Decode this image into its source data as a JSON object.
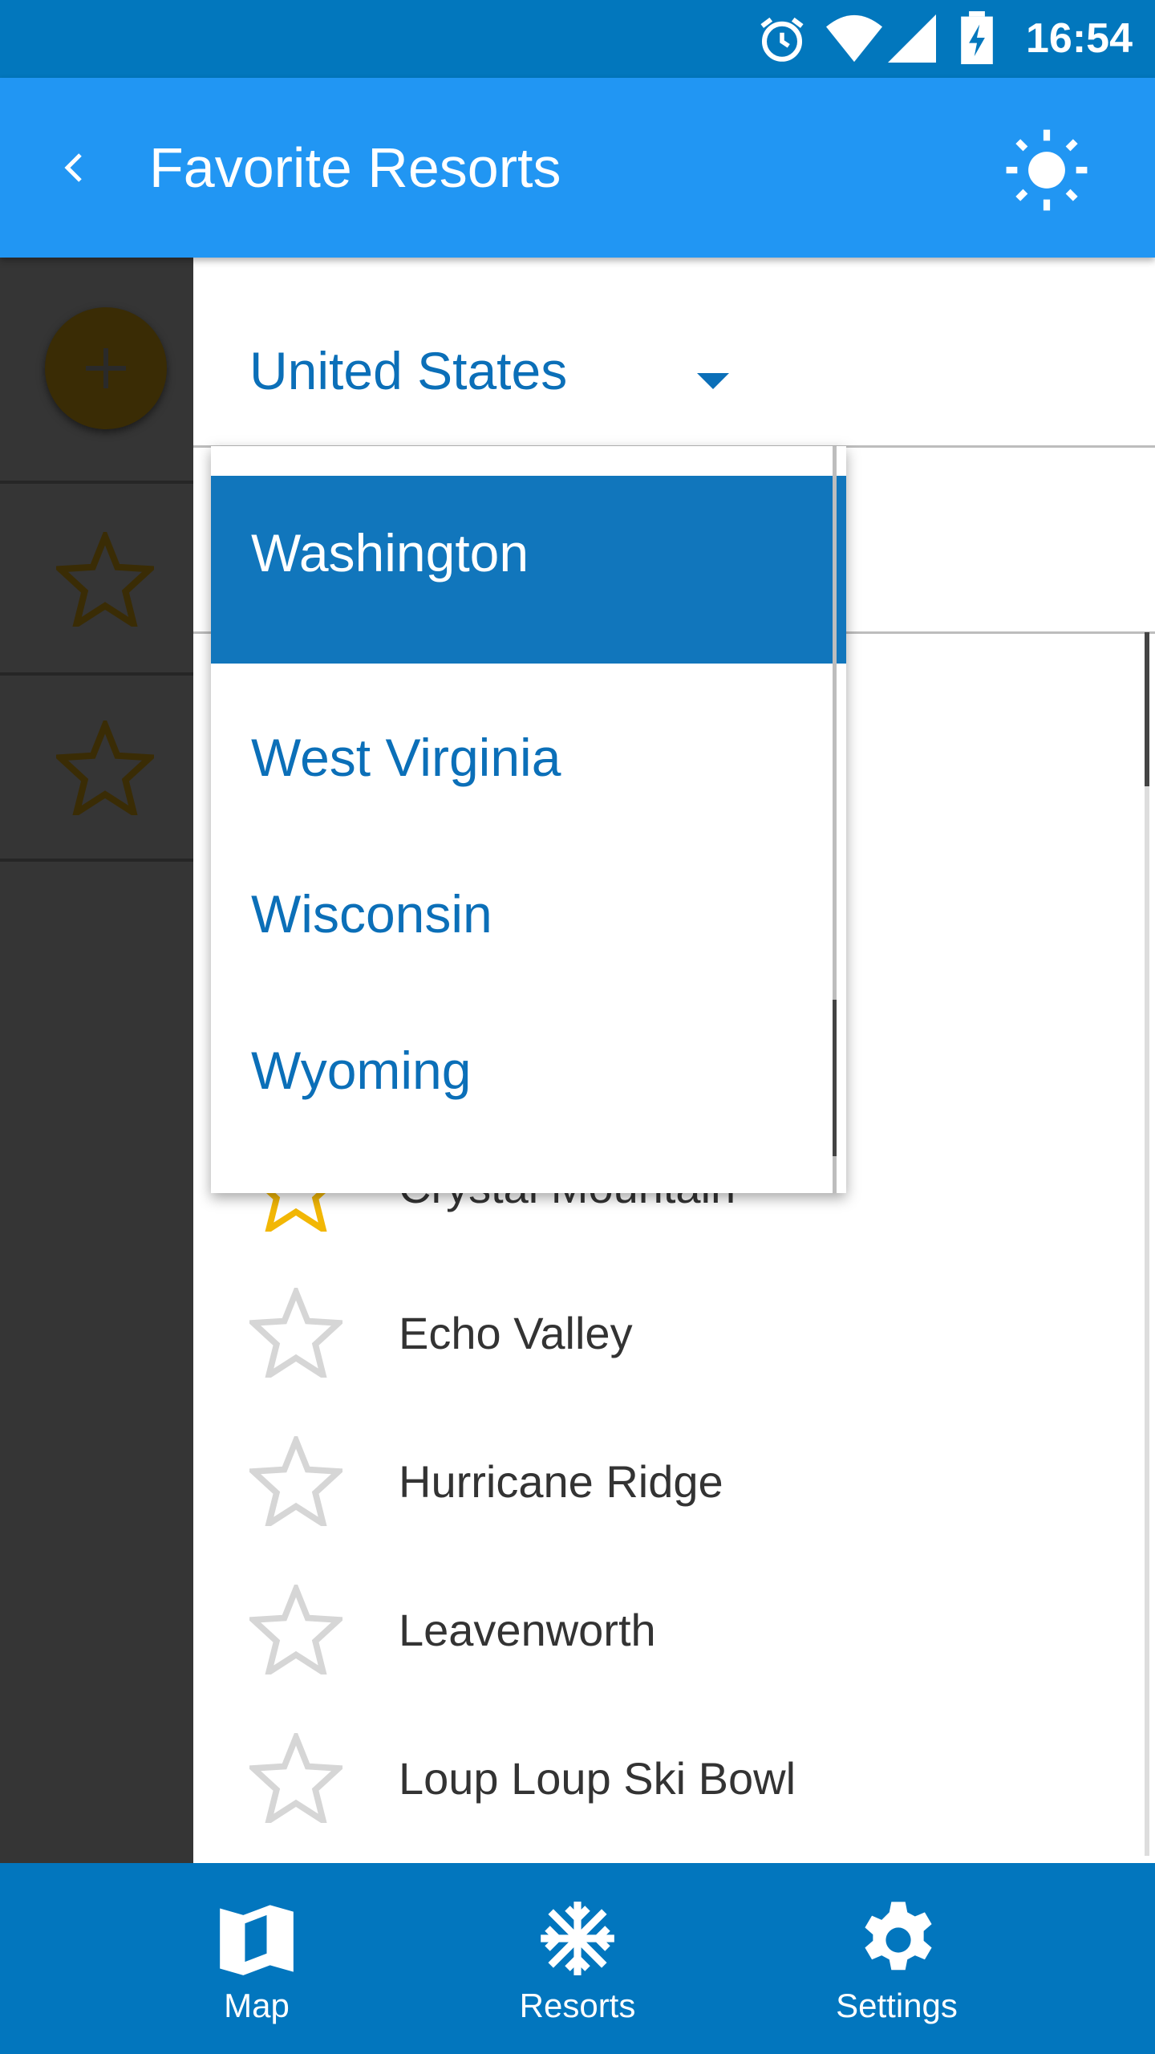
{
  "status_bar": {
    "time": "16:54",
    "icons": [
      "alarm-icon",
      "wifi-icon",
      "signal-icon",
      "battery-charging-icon"
    ]
  },
  "app_bar": {
    "title": "Favorite Resorts",
    "back_icon": "chevron-left-icon",
    "theme_icon": "sun-icon"
  },
  "country_spinner": {
    "selected": "United States"
  },
  "state_dropdown": {
    "options": [
      {
        "label": "Washington",
        "selected": true
      },
      {
        "label": "West Virginia"
      },
      {
        "label": "Wisconsin"
      },
      {
        "label": "Wyoming"
      }
    ]
  },
  "resorts": [
    {
      "name": "Crystal Mountain",
      "favorite": true
    },
    {
      "name": "Echo Valley",
      "favorite": false
    },
    {
      "name": "Hurricane Ridge",
      "favorite": false
    },
    {
      "name": "Leavenworth",
      "favorite": false
    },
    {
      "name": "Loup Loup Ski Bowl",
      "favorite": false
    }
  ],
  "bottom_nav": [
    {
      "label": "Map",
      "icon": "map-icon"
    },
    {
      "label": "Resorts",
      "icon": "snowflake-icon"
    },
    {
      "label": "Settings",
      "icon": "gear-icon"
    }
  ],
  "colors": {
    "status_bar": "#0277BD",
    "app_bar": "#2196F3",
    "accent": "#0B6FB8",
    "favorite": "#F2B705",
    "nav": "#0276BE"
  }
}
